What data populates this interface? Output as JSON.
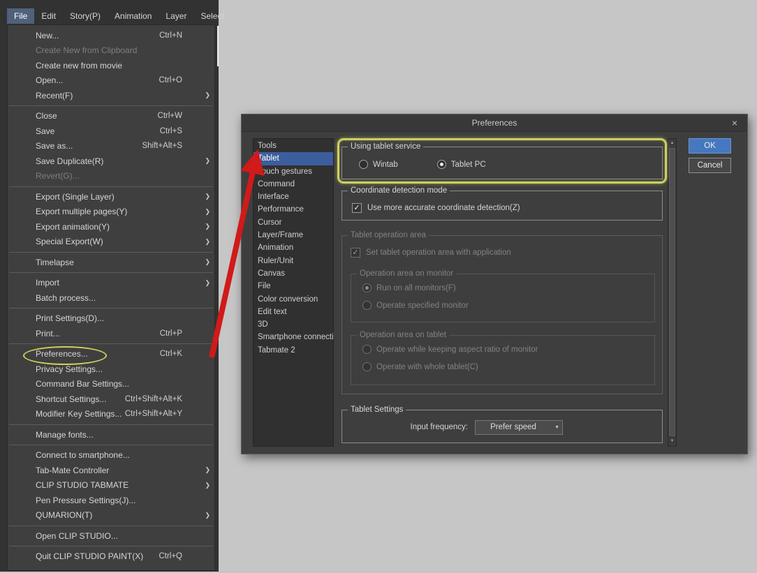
{
  "menubar": {
    "items": [
      {
        "label": "File",
        "active": true
      },
      {
        "label": "Edit"
      },
      {
        "label": "Story(P)"
      },
      {
        "label": "Animation"
      },
      {
        "label": "Layer"
      },
      {
        "label": "Select"
      }
    ]
  },
  "file_menu": {
    "items": [
      {
        "label": "New...",
        "shortcut": "Ctrl+N"
      },
      {
        "label": "Create New from Clipboard",
        "disabled": true
      },
      {
        "label": "Create new from movie"
      },
      {
        "label": "Open...",
        "shortcut": "Ctrl+O"
      },
      {
        "label": "Recent(F)",
        "submenu": true
      },
      {
        "separator": true
      },
      {
        "label": "Close",
        "shortcut": "Ctrl+W"
      },
      {
        "label": "Save",
        "shortcut": "Ctrl+S"
      },
      {
        "label": "Save as...",
        "shortcut": "Shift+Alt+S"
      },
      {
        "label": "Save Duplicate(R)",
        "submenu": true
      },
      {
        "label": "Revert(G)...",
        "disabled": true
      },
      {
        "separator": true
      },
      {
        "label": "Export (Single Layer)",
        "submenu": true
      },
      {
        "label": "Export multiple pages(Y)",
        "submenu": true
      },
      {
        "label": "Export animation(Y)",
        "submenu": true
      },
      {
        "label": "Special Export(W)",
        "submenu": true
      },
      {
        "separator": true
      },
      {
        "label": "Timelapse",
        "submenu": true
      },
      {
        "separator": true
      },
      {
        "label": "Import",
        "submenu": true
      },
      {
        "label": "Batch process..."
      },
      {
        "separator": true
      },
      {
        "label": "Print Settings(D)..."
      },
      {
        "label": "Print...",
        "shortcut": "Ctrl+P"
      },
      {
        "separator": true
      },
      {
        "label": "Preferences...",
        "shortcut": "Ctrl+K",
        "highlighted": true
      },
      {
        "label": "Privacy Settings..."
      },
      {
        "label": "Command Bar Settings..."
      },
      {
        "label": "Shortcut Settings...",
        "shortcut": "Ctrl+Shift+Alt+K"
      },
      {
        "label": "Modifier Key Settings...",
        "shortcut": "Ctrl+Shift+Alt+Y"
      },
      {
        "separator": true
      },
      {
        "label": "Manage fonts..."
      },
      {
        "separator": true
      },
      {
        "label": "Connect to smartphone..."
      },
      {
        "label": "Tab-Mate Controller",
        "submenu": true
      },
      {
        "label": "CLIP STUDIO TABMATE",
        "submenu": true
      },
      {
        "label": "Pen Pressure Settings(J)..."
      },
      {
        "label": "QUMARION(T)",
        "submenu": true
      },
      {
        "separator": true
      },
      {
        "label": "Open CLIP STUDIO..."
      },
      {
        "separator": true
      },
      {
        "label": "Quit CLIP STUDIO PAINT(X)",
        "shortcut": "Ctrl+Q"
      }
    ]
  },
  "dialog": {
    "title": "Preferences",
    "ok_label": "OK",
    "cancel_label": "Cancel",
    "categories": [
      {
        "label": "Tools"
      },
      {
        "label": "Tablet",
        "selected": true
      },
      {
        "label": "Touch gestures"
      },
      {
        "label": "Command"
      },
      {
        "label": "Interface"
      },
      {
        "label": "Performance"
      },
      {
        "label": "Cursor"
      },
      {
        "label": "Layer/Frame"
      },
      {
        "label": "Animation"
      },
      {
        "label": "Ruler/Unit"
      },
      {
        "label": "Canvas"
      },
      {
        "label": "File"
      },
      {
        "label": "Color conversion"
      },
      {
        "label": "Edit text"
      },
      {
        "label": "3D"
      },
      {
        "label": "Smartphone connection"
      },
      {
        "label": "Tabmate 2"
      }
    ],
    "groups": {
      "tablet_service": {
        "title": "Using tablet service",
        "options": [
          {
            "label": "Wintab"
          },
          {
            "label": "Tablet PC",
            "selected": true
          }
        ]
      },
      "coordinate": {
        "title": "Coordinate detection mode",
        "checkbox_label": "Use more accurate coordinate detection(Z)",
        "checked": true
      },
      "operation_area": {
        "title": "Tablet operation area",
        "checkbox_label": "Set tablet operation area with application",
        "checked": true,
        "disabled": true,
        "monitor": {
          "title": "Operation area on monitor",
          "options": [
            {
              "label": "Run on all monitors(F)",
              "selected": true
            },
            {
              "label": "Operate specified monitor"
            }
          ]
        },
        "tablet": {
          "title": "Operation area on tablet",
          "options": [
            {
              "label": "Operate while keeping aspect ratio of monitor"
            },
            {
              "label": "Operate with whole tablet(C)"
            }
          ]
        }
      },
      "tablet_settings": {
        "title": "Tablet Settings",
        "input_frequency_label": "Input frequency:",
        "input_frequency_value": "Prefer speed"
      }
    }
  },
  "icons": {
    "submenu_arrow": "❯",
    "close": "×",
    "check": "✓",
    "dropdown_arrow": "▼",
    "scroll_up": "▲",
    "scroll_down": "▼"
  },
  "colors": {
    "selection-blue": "#3d5e9c",
    "ok-blue": "#4678c0",
    "menubar-active": "#50617b",
    "highlight-yellow": "#cfcf5e",
    "arrow-red": "#d11a1a"
  }
}
